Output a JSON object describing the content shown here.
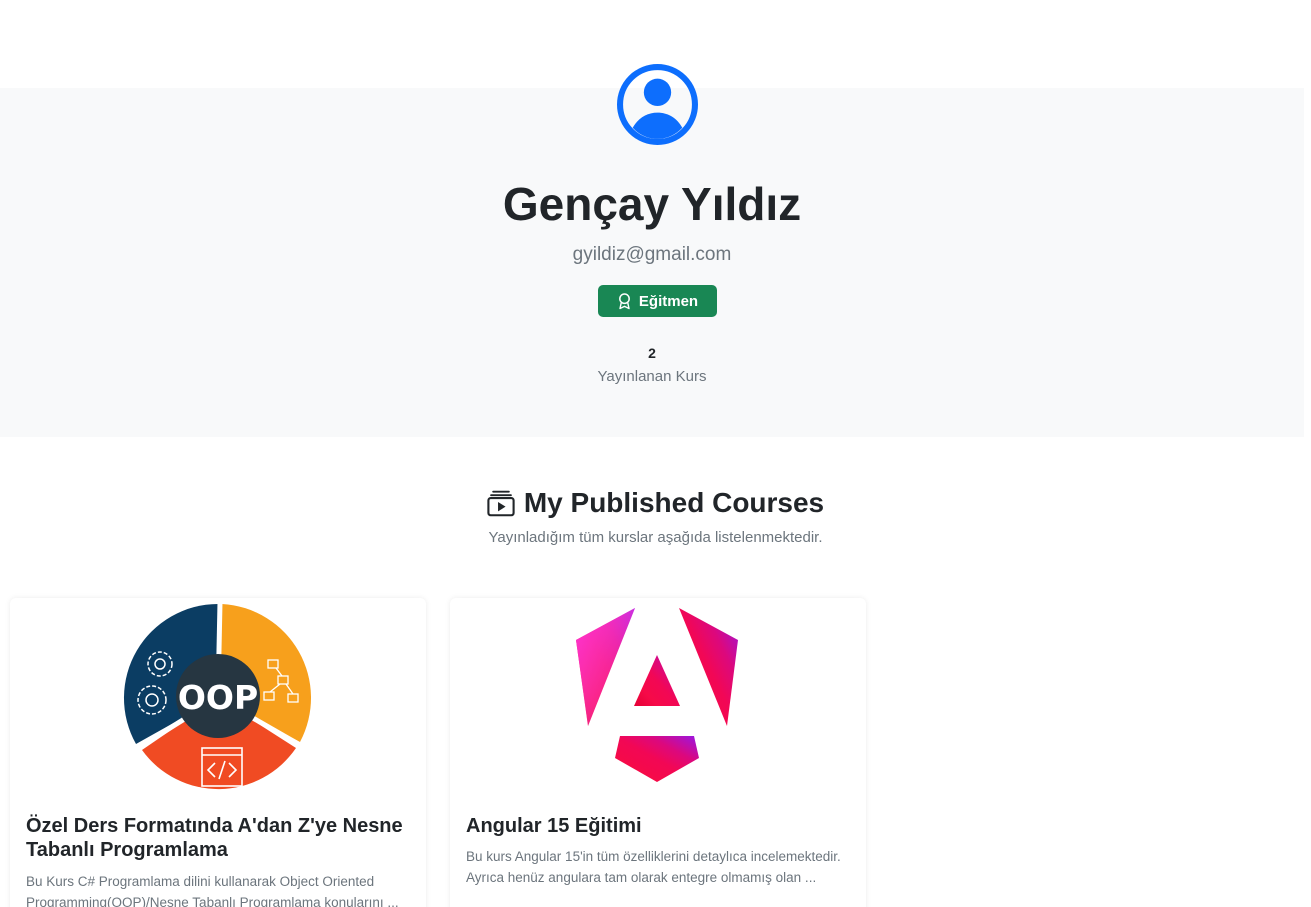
{
  "profile": {
    "name": "Gençay Yıldız",
    "email": "gyildiz@gmail.com",
    "role_badge": "Eğitmen",
    "published_count": "2",
    "published_label": "Yayınlanan Kurs"
  },
  "courses_section": {
    "title": "My Published Courses",
    "subtitle": "Yayınladığım tüm kurslar aşağıda listelenmektedir."
  },
  "courses": [
    {
      "title": "Özel Ders Formatında A'dan Z'ye Nesne Tabanlı Programlama",
      "image_label": "OOP",
      "description": "Bu Kurs C# Programlama dilini kullanarak Object Oriented Programming(OOP)/Nesne Tabanlı Programlama konularını ..."
    },
    {
      "title": "Angular 15 Eğitimi",
      "image_label": "A",
      "description": "Bu kurs Angular 15'in tüm özelliklerini detaylıca incelemektedir. Ayrıca henüz angulara tam olarak entegre olmamış olan ..."
    }
  ],
  "colors": {
    "primary": "#0d6efd",
    "success": "#198754",
    "hero_bg": "#f8f9fa",
    "muted": "#6c757d"
  },
  "icons": {
    "avatar": "person-circle-icon",
    "badge": "award-icon",
    "section": "collection-play-icon"
  }
}
